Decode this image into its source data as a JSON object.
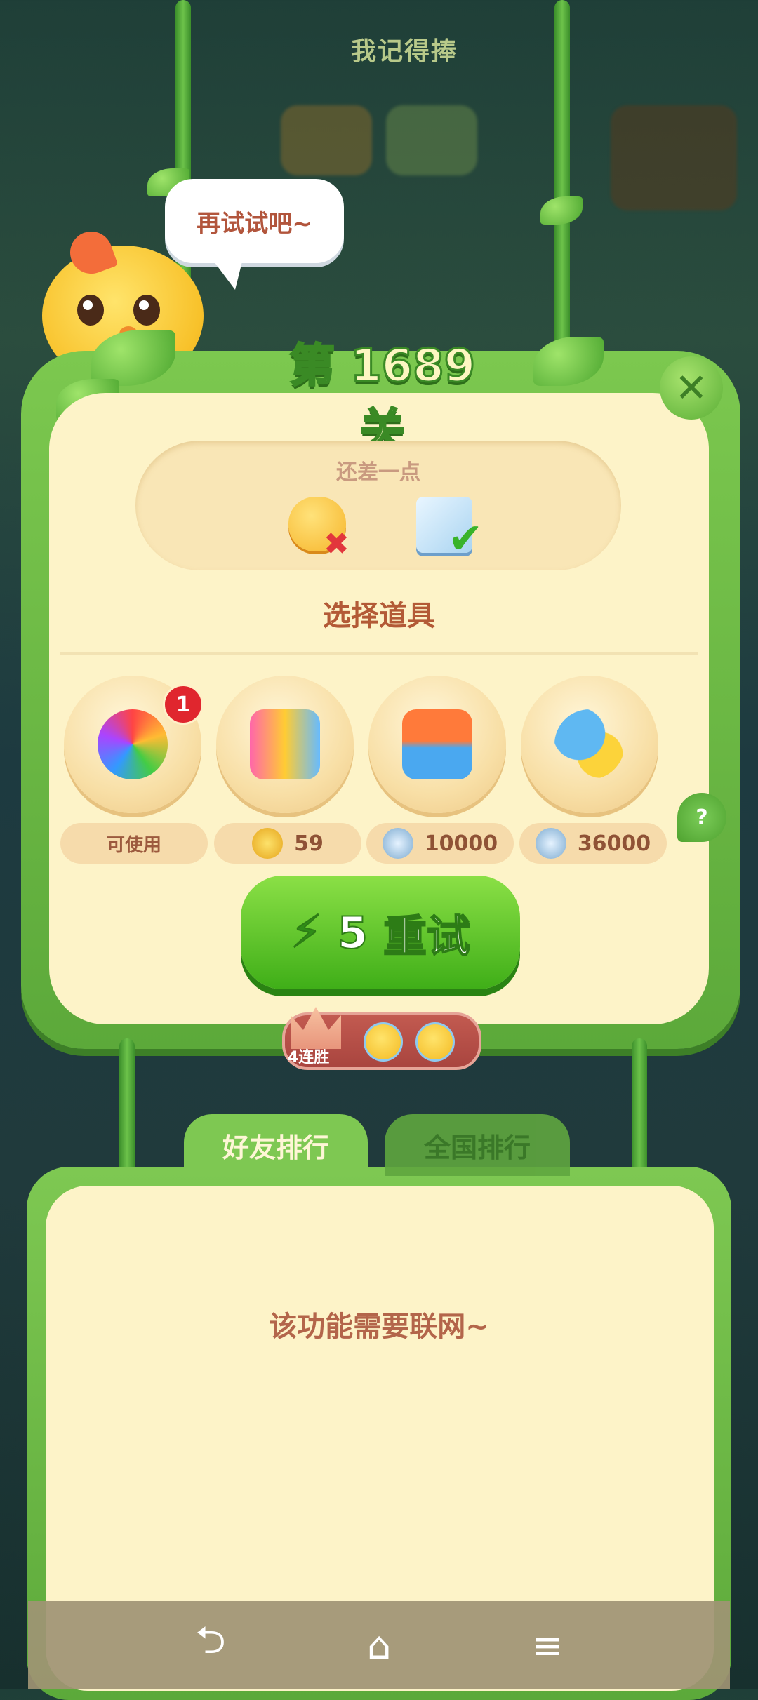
{
  "top_hint": "我记得捧",
  "bubble_text": "再试试吧~",
  "level_title": "第 1689 关",
  "close_label": "✕",
  "goal": {
    "label": "还差一点"
  },
  "section_title": "选择道具",
  "items": [
    {
      "name": "rainbow-owl",
      "badge": "1",
      "price": "可使用",
      "currency": "none"
    },
    {
      "name": "rockets",
      "price": "59",
      "currency": "gold-coin"
    },
    {
      "name": "plus-three-moves",
      "price": "10000",
      "currency": "silver-coin"
    },
    {
      "name": "hippo-chick",
      "price": "36000",
      "currency": "silver-coin"
    }
  ],
  "help_label": "?",
  "retry": {
    "energy": "5",
    "label": "重试"
  },
  "streak": {
    "label": "4连胜"
  },
  "tabs": {
    "friends": "好友排行",
    "national": "全国排行"
  },
  "board_message": "该功能需要联网~",
  "nav": {
    "back": "⮌",
    "home": "⌂",
    "menu": "≡"
  },
  "colors": {
    "panel_green": "#7cc84f",
    "cream": "#fdf3c8",
    "retry_green": "#3fae18",
    "title_brown": "#b35a36"
  }
}
